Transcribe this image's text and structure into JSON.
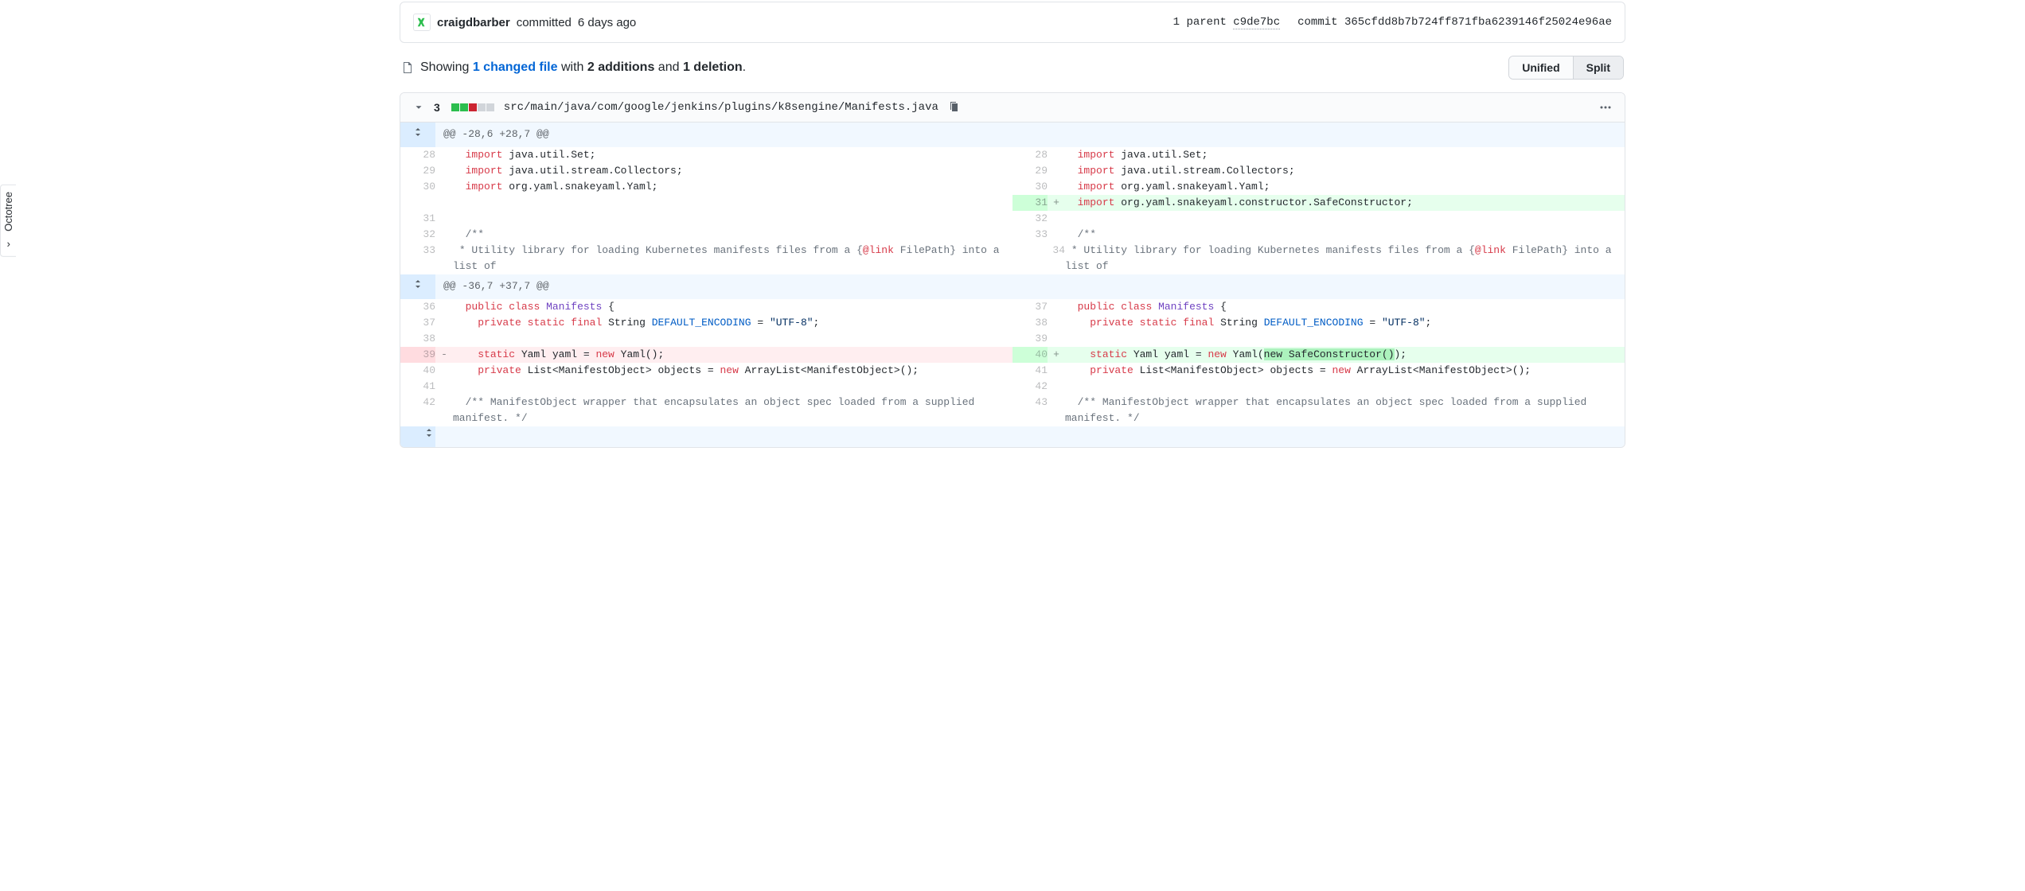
{
  "commit": {
    "author": "craigdbarber",
    "action": "committed",
    "time_ago": "6 days ago",
    "parent_label": "1 parent",
    "parent_sha": "c9de7bc",
    "commit_label": "commit",
    "sha": "365cfdd8b7b724ff871fba6239146f25024e96ae"
  },
  "changes_bar": {
    "showing": "Showing",
    "files_link": "1 changed file",
    "with": "with",
    "additions": "2 additions",
    "and": "and",
    "deletions": "1 deletion",
    "period": "."
  },
  "view_toggle": {
    "unified": "Unified",
    "split": "Split"
  },
  "file": {
    "change_count": "3",
    "path": "src/main/java/com/google/jenkins/plugins/k8sengine/Manifests.java"
  },
  "hunks": {
    "h1": "@@ -28,6 +28,7 @@",
    "h2": "@@ -36,7 +37,7 @@"
  },
  "lines": {
    "l28": {
      "oln": "28",
      "nln": "28"
    },
    "l29": {
      "oln": "29",
      "nln": "29"
    },
    "l30": {
      "oln": "30",
      "nln": "30"
    },
    "l31a": {
      "nln": "31"
    },
    "l31": {
      "oln": "31",
      "nln": "32"
    },
    "l32": {
      "oln": "32",
      "nln": "33"
    },
    "l33": {
      "oln": "33",
      "nln": "34"
    },
    "l36": {
      "oln": "36",
      "nln": "37"
    },
    "l37": {
      "oln": "37",
      "nln": "38"
    },
    "l38": {
      "oln": "38",
      "nln": "39"
    },
    "l39d": {
      "oln": "39"
    },
    "l40a": {
      "nln": "40"
    },
    "l40": {
      "oln": "40",
      "nln": "41"
    },
    "l41": {
      "oln": "41",
      "nln": "42"
    },
    "l42": {
      "oln": "42",
      "nln": "43"
    }
  },
  "code": {
    "import": "import",
    "public": "public",
    "class": "class",
    "private": "private",
    "static": "static",
    "final": "final",
    "new": "new",
    "set": " java.util.Set;",
    "collectors": " java.util.stream.Collectors;",
    "yaml_imp": " org.yaml.snakeyaml.Yaml;",
    "safe_imp": " org.yaml.snakeyaml.constructor.SafeConstructor;",
    "javadoc_open": "/**",
    "javadoc_line": " * Utility library for loading Kubernetes manifests files from a {",
    "javadoc_tag": "@link",
    "javadoc_cont": " FilePath} into a list of",
    "manifests": "Manifests",
    "brace": " {",
    "string_t": " String ",
    "default_enc": "DEFAULT_ENCODING",
    "eq_utf": " = ",
    "utf8": "\"UTF-8\"",
    "semi": ";",
    "yaml_t": " Yaml yaml = ",
    "yaml_call": " Yaml();",
    "yaml_call_new_pre": " Yaml(",
    "yaml_call_new_hl": "new SafeConstructor()",
    "yaml_call_new_post": ");",
    "list_line": " List<ManifestObject> objects = ",
    "arraylist": " ArrayList<ManifestObject>();",
    "mo_doc": "  /** ManifestObject wrapper that encapsulates an object spec loaded from a supplied manifest. */"
  },
  "octotree": "Octotree"
}
